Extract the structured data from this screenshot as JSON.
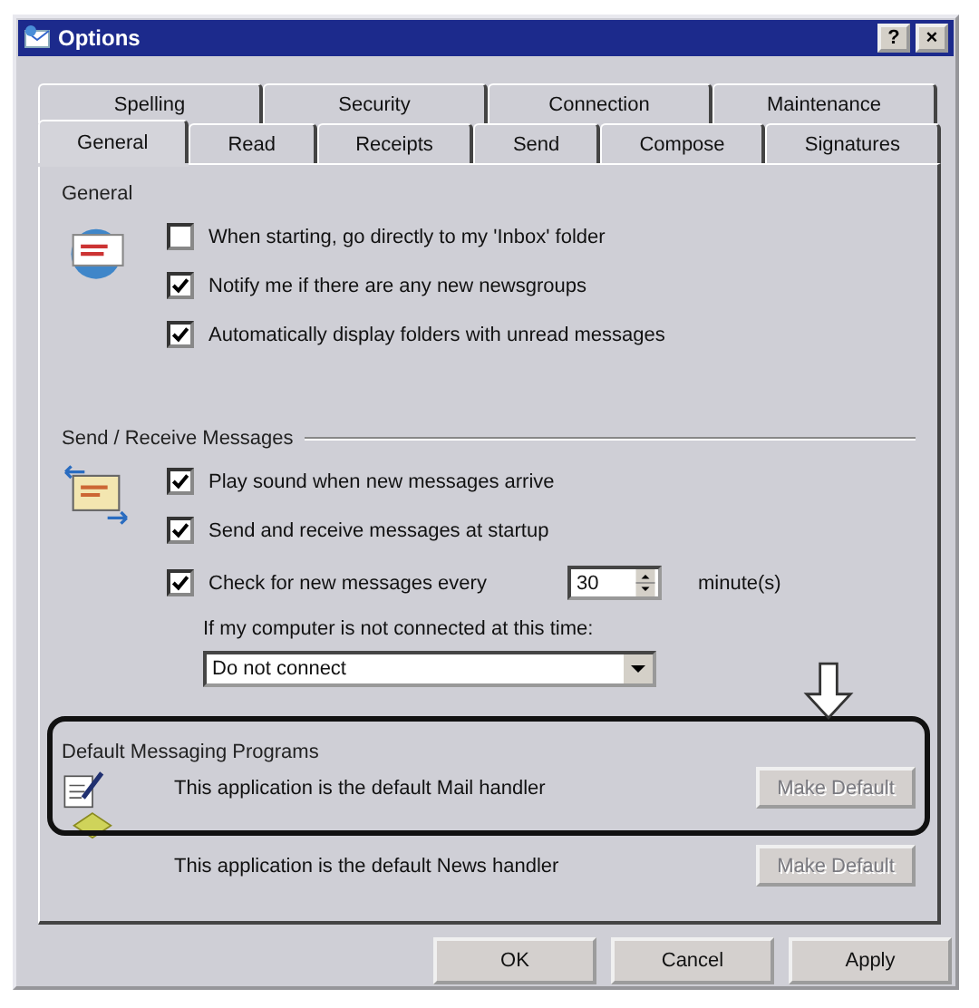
{
  "window": {
    "title": "Options",
    "help_button": "?",
    "close_button": "×"
  },
  "tabs": {
    "back_row": [
      {
        "label": "Spelling",
        "selected": false
      },
      {
        "label": "Security",
        "selected": false
      },
      {
        "label": "Connection",
        "selected": false
      },
      {
        "label": "Maintenance",
        "selected": false
      }
    ],
    "front_row": [
      {
        "label": "General",
        "selected": true
      },
      {
        "label": "Read",
        "selected": false
      },
      {
        "label": "Receipts",
        "selected": false
      },
      {
        "label": "Send",
        "selected": false
      },
      {
        "label": "Compose",
        "selected": false
      },
      {
        "label": "Signatures",
        "selected": false
      }
    ]
  },
  "general": {
    "heading": "General",
    "options": [
      {
        "label": "When starting, go directly to my 'Inbox' folder",
        "checked": false
      },
      {
        "label": "Notify me if there are any new newsgroups",
        "checked": true
      },
      {
        "label": "Automatically display folders with unread messages",
        "checked": true
      }
    ]
  },
  "send_receive": {
    "heading": "Send / Receive Messages",
    "options": [
      {
        "label": "Play sound when new messages arrive",
        "checked": true
      },
      {
        "label": "Send and receive messages at startup",
        "checked": true
      }
    ],
    "check_every": {
      "label": "Check for new messages every",
      "checked": true,
      "value": "30",
      "unit": "minute(s)"
    },
    "offline_label": "If my computer is not connected at this time:",
    "offline_select": {
      "value": "Do not connect"
    }
  },
  "default_programs": {
    "heading": "Default Messaging Programs",
    "handlers": [
      {
        "text": "This application is the default Mail handler",
        "button": "Make Default",
        "disabled": true
      },
      {
        "text": "This application is the default News handler",
        "button": "Make Default",
        "disabled": true
      }
    ]
  },
  "buttons": [
    "OK",
    "Cancel",
    "Apply"
  ]
}
